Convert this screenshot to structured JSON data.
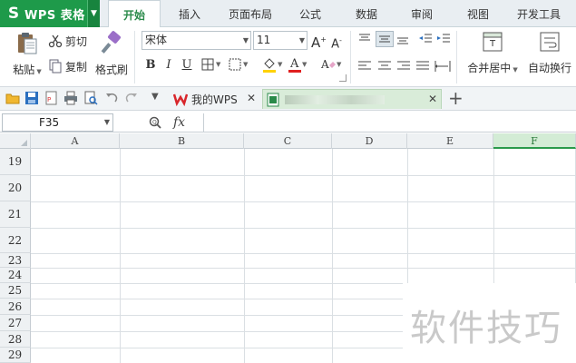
{
  "app": {
    "name": "WPS 表格",
    "logo": "S"
  },
  "menu": {
    "tabs": [
      {
        "label": "开始",
        "active": true
      },
      {
        "label": "插入"
      },
      {
        "label": "页面布局"
      },
      {
        "label": "公式"
      },
      {
        "label": "数据"
      },
      {
        "label": "审阅"
      },
      {
        "label": "视图"
      },
      {
        "label": "开发工具"
      }
    ]
  },
  "ribbon": {
    "paste": "粘贴",
    "cut": "剪切",
    "copy": "复制",
    "format_painter": "格式刷",
    "font_name": "宋体",
    "font_size": "11",
    "bold": "B",
    "italic": "I",
    "underline": "U",
    "merge_center": "合并居中",
    "wrap_text": "自动换行"
  },
  "doc_tabs": [
    {
      "label": "我的WPS"
    },
    {
      "label": "",
      "active": true
    }
  ],
  "formula_bar": {
    "cell_ref": "F35",
    "fx": "fx",
    "formula": ""
  },
  "grid": {
    "columns": [
      "A",
      "B",
      "C",
      "D",
      "E",
      "F"
    ],
    "selected_column": "F",
    "rows": [
      "19",
      "20",
      "21",
      "22",
      "23",
      "24",
      "25",
      "26",
      "27",
      "28",
      "29"
    ]
  },
  "watermark": "软件技巧",
  "colors": {
    "brand_green": "#1e9a4a",
    "active_tab_text": "#2a8a4a",
    "selected_col": "#d3ecd5"
  }
}
